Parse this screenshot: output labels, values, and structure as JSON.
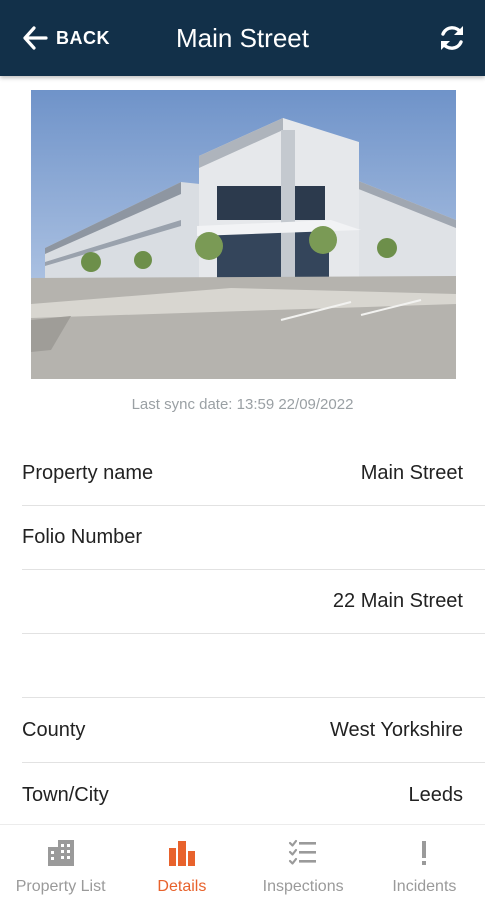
{
  "header": {
    "back_label": "BACK",
    "title": "Main Street"
  },
  "property": {
    "sync_date": "Last sync date: 13:59 22/09/2022",
    "rows": [
      {
        "label": "Property name",
        "value": "Main Street"
      },
      {
        "label": "Folio Number",
        "value": ""
      },
      {
        "label": "",
        "value": "22 Main Street"
      },
      {
        "label": "",
        "value": ""
      },
      {
        "label": "County",
        "value": "West Yorkshire"
      },
      {
        "label": "Town/City",
        "value": "Leeds"
      }
    ]
  },
  "nav": {
    "items": [
      {
        "label": "Property List",
        "icon": "building-icon",
        "active": false
      },
      {
        "label": "Details",
        "icon": "bar-chart-icon",
        "active": true
      },
      {
        "label": "Inspections",
        "icon": "checklist-icon",
        "active": false
      },
      {
        "label": "Incidents",
        "icon": "exclamation-icon",
        "active": false
      }
    ]
  },
  "colors": {
    "appbar": "#123049",
    "accent": "#e8622c",
    "inactive": "#9a9a9a"
  }
}
